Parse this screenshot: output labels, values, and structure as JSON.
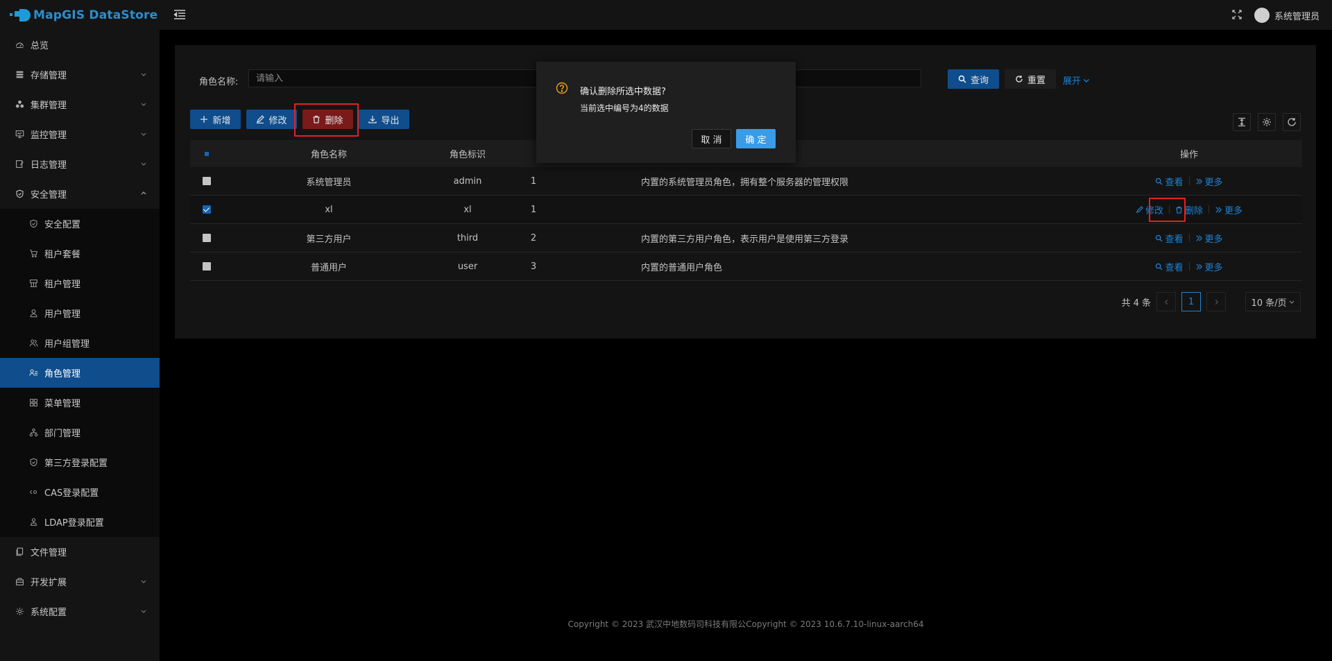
{
  "app": {
    "logo_text": "MapGIS DataStore"
  },
  "sidebar": {
    "items": [
      {
        "label": "总览",
        "icon": "dashboard-icon",
        "has_children": false
      },
      {
        "label": "存储管理",
        "icon": "storage-icon",
        "has_children": true
      },
      {
        "label": "集群管理",
        "icon": "cluster-icon",
        "has_children": true
      },
      {
        "label": "监控管理",
        "icon": "monitor-icon",
        "has_children": true
      },
      {
        "label": "日志管理",
        "icon": "log-icon",
        "has_children": true
      },
      {
        "label": "安全管理",
        "icon": "shield-icon",
        "has_children": true,
        "expanded": true
      }
    ],
    "children": [
      {
        "label": "安全配置",
        "icon": "shield-icon"
      },
      {
        "label": "租户套餐",
        "icon": "cart-icon"
      },
      {
        "label": "租户管理",
        "icon": "tenant-icon"
      },
      {
        "label": "用户管理",
        "icon": "user-icon"
      },
      {
        "label": "用户组管理",
        "icon": "user-group-icon"
      },
      {
        "label": "角色管理",
        "icon": "role-icon",
        "active": true
      },
      {
        "label": "菜单管理",
        "icon": "menu-icon"
      },
      {
        "label": "部门管理",
        "icon": "department-icon"
      },
      {
        "label": "第三方登录配置",
        "icon": "shield-icon"
      },
      {
        "label": "CAS登录配置",
        "icon": "cas-icon"
      },
      {
        "label": "LDAP登录配置",
        "icon": "ldap-icon"
      }
    ],
    "bottom_items": [
      {
        "label": "文件管理",
        "icon": "file-icon",
        "has_children": false
      },
      {
        "label": "开发扩展",
        "icon": "extension-icon",
        "has_children": true
      },
      {
        "label": "系统配置",
        "icon": "gear-icon",
        "has_children": true
      }
    ]
  },
  "header": {
    "user_name": "系统管理员"
  },
  "search": {
    "label": "角色名称:",
    "placeholder": "请输入",
    "query_label": "查询",
    "reset_label": "重置",
    "expand_label": "展开"
  },
  "toolbar": {
    "add_label": "新增",
    "edit_label": "修改",
    "delete_label": "删除",
    "export_label": "导出"
  },
  "table": {
    "columns": {
      "name": "角色名称",
      "code": "角色标识",
      "ops": "操作"
    },
    "rows": [
      {
        "name": "系统管理员",
        "code": "admin",
        "sort": "1",
        "desc": "内置的系统管理员角色，拥有整个服务器的管理权限",
        "checked": false,
        "ops": [
          "查看",
          "更多"
        ]
      },
      {
        "name": "xl",
        "code": "xl",
        "sort": "1",
        "desc": "",
        "checked": true,
        "ops": [
          "修改",
          "删除",
          "更多"
        ]
      },
      {
        "name": "第三方用户",
        "code": "third",
        "sort": "2",
        "desc": "内置的第三方用户角色，表示用户是使用第三方登录",
        "checked": false,
        "ops": [
          "查看",
          "更多"
        ]
      },
      {
        "name": "普通用户",
        "code": "user",
        "sort": "3",
        "desc": "内置的普通用户角色",
        "checked": false,
        "ops": [
          "查看",
          "更多"
        ]
      }
    ]
  },
  "pagination": {
    "total": "共 4 条",
    "current": "1",
    "page_size": "10 条/页"
  },
  "popconfirm": {
    "title": "确认删除所选中数据?",
    "description": "当前选中编号为4的数据",
    "cancel_label": "取 消",
    "ok_label": "确 定"
  },
  "footer": {
    "text": "Copyright © 2023 武汉中地数码司科技有限公Copyright © 2023 10.6.7.10-linux-aarch64"
  },
  "colors": {
    "primary": "#0f4d8c",
    "link": "#1d82d6",
    "danger": "#7b1a1a",
    "highlight": "#e82020",
    "ok": "#3a9ce6"
  }
}
